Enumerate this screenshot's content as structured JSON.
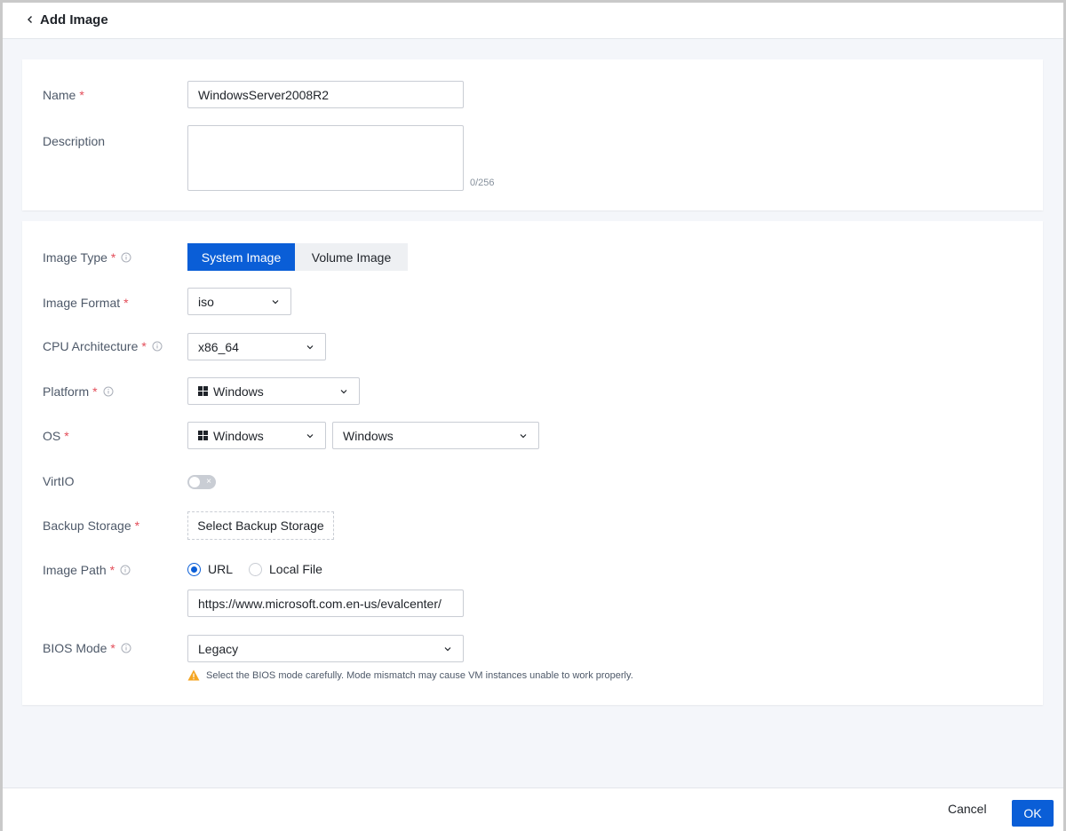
{
  "header": {
    "title": "Add Image"
  },
  "basic": {
    "name_label": "Name",
    "name_value": "WindowsServer2008R2",
    "description_label": "Description",
    "description_value": "",
    "description_counter": "0/256"
  },
  "config": {
    "required_mark": "*",
    "image_type": {
      "label": "Image Type",
      "options": [
        "System Image",
        "Volume Image"
      ],
      "selected": "System Image"
    },
    "image_format": {
      "label": "Image Format",
      "value": "iso"
    },
    "cpu_architecture": {
      "label": "CPU Architecture",
      "value": "x86_64"
    },
    "platform": {
      "label": "Platform",
      "value": "Windows"
    },
    "os": {
      "label": "OS",
      "family": "Windows",
      "version": "Windows"
    },
    "virtio": {
      "label": "VirtIO",
      "enabled": false,
      "off_glyph": "×"
    },
    "backup_storage": {
      "label": "Backup Storage",
      "button_label": "Select Backup Storage"
    },
    "image_path": {
      "label": "Image Path",
      "options": [
        "URL",
        "Local File"
      ],
      "selected": "URL",
      "url_value": "https://www.microsoft.com.en-us/evalcenter/"
    },
    "bios_mode": {
      "label": "BIOS Mode",
      "value": "Legacy",
      "warning": "Select the BIOS mode carefully. Mode mismatch may cause VM instances unable to work properly."
    }
  },
  "footer": {
    "cancel_label": "Cancel",
    "ok_label": "OK"
  },
  "colors": {
    "primary": "#0a5ed7",
    "required": "#e34d59",
    "warning": "#f5a623"
  }
}
